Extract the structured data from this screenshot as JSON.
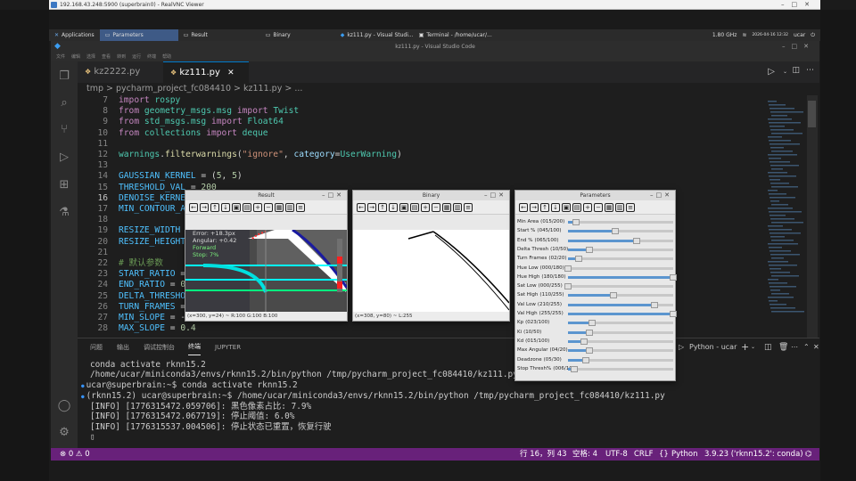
{
  "vnc": {
    "title": "192.168.43.248:5900 (superbrain0) - RealVNC Viewer"
  },
  "taskbar": {
    "applications": "Applications",
    "items": [
      "Parameters",
      "Result",
      "Binary",
      "kz111.py - Visual Studi...",
      "Terminal - /home/ucar/..."
    ],
    "freq": "1.80 GHz",
    "clock": "2026-04-16 12:32",
    "user": "ucar"
  },
  "window": {
    "title": "kz111.py - Visual Studio Code"
  },
  "menu": [
    "文件",
    "编辑",
    "选择",
    "查看",
    "转到",
    "运行",
    "终端",
    "帮助"
  ],
  "tabs": [
    {
      "label": "kz2222.py"
    },
    {
      "label": "kz111.py",
      "close": "✕"
    }
  ],
  "breadcrumb": {
    "text": "tmp > pycharm_project_fc084410 > kz111.py > ..."
  },
  "editor": {
    "line_numbers": [
      "7",
      "8",
      "9",
      "10",
      "11",
      "12",
      "13",
      "14",
      "15",
      "16",
      "17",
      "18",
      "19",
      "20",
      "21",
      "22",
      "23",
      "24",
      "25",
      "26",
      "27",
      "28"
    ],
    "lines": [
      [
        {
          "t": "import ",
          "c": "kw"
        },
        {
          "t": "rospy",
          "c": "cl"
        }
      ],
      [
        {
          "t": "from ",
          "c": "kw"
        },
        {
          "t": "geometry_msgs.msg",
          "c": "cl"
        },
        {
          "t": " import ",
          "c": "kw"
        },
        {
          "t": "Twist",
          "c": "cl"
        }
      ],
      [
        {
          "t": "from ",
          "c": "kw"
        },
        {
          "t": "std_msgs.msg",
          "c": "cl"
        },
        {
          "t": " import ",
          "c": "kw"
        },
        {
          "t": "Float64",
          "c": "cl"
        }
      ],
      [
        {
          "t": "from ",
          "c": "kw"
        },
        {
          "t": "collections",
          "c": "cl"
        },
        {
          "t": " import ",
          "c": "kw"
        },
        {
          "t": "deque",
          "c": "cl"
        }
      ],
      [],
      [
        {
          "t": "warnings",
          "c": "cl"
        },
        {
          "t": ".",
          "c": ""
        },
        {
          "t": "filterwarnings",
          "c": "fn"
        },
        {
          "t": "(",
          "c": ""
        },
        {
          "t": "\"ignore\"",
          "c": "str"
        },
        {
          "t": ", ",
          "c": ""
        },
        {
          "t": "category",
          "c": "pl"
        },
        {
          "t": "=",
          "c": ""
        },
        {
          "t": "UserWarning",
          "c": "cl"
        },
        {
          "t": ")",
          "c": ""
        }
      ],
      [],
      [
        {
          "t": "GAUSSIAN_KERNEL",
          "c": "cst"
        },
        {
          "t": " = (",
          "c": ""
        },
        {
          "t": "5",
          "c": "num"
        },
        {
          "t": ", ",
          "c": ""
        },
        {
          "t": "5",
          "c": "num"
        },
        {
          "t": ")",
          "c": ""
        }
      ],
      [
        {
          "t": "THRESHOLD_VAL",
          "c": "cst"
        },
        {
          "t": " = ",
          "c": ""
        },
        {
          "t": "200",
          "c": "num"
        }
      ],
      [
        {
          "t": "DENOISE_KERNEL",
          "c": "cst"
        }
      ],
      [
        {
          "t": "MIN_CONTOUR_AREA",
          "c": "cst"
        }
      ],
      [],
      [
        {
          "t": "RESIZE_WIDTH",
          "c": "cst"
        },
        {
          "t": " =",
          "c": ""
        }
      ],
      [
        {
          "t": "RESIZE_HEIGHT",
          "c": "cst"
        }
      ],
      [],
      [
        {
          "t": "# 默认参数",
          "c": "cm"
        }
      ],
      [
        {
          "t": "START_RATIO",
          "c": "cst"
        },
        {
          "t": " =",
          "c": ""
        }
      ],
      [
        {
          "t": "END_RATIO",
          "c": "cst"
        },
        {
          "t": " = ",
          "c": ""
        },
        {
          "t": "0.",
          "c": "num"
        }
      ],
      [
        {
          "t": "DELTA_THRESHOLD",
          "c": "cst"
        }
      ],
      [
        {
          "t": "TURN_FRAMES",
          "c": "cst"
        },
        {
          "t": " =",
          "c": ""
        }
      ],
      [
        {
          "t": "MIN_SLOPE",
          "c": "cst"
        },
        {
          "t": " = -",
          "c": ""
        }
      ],
      [
        {
          "t": "MAX_SLOPE",
          "c": "cst"
        },
        {
          "t": " = ",
          "c": ""
        },
        {
          "t": "0.4",
          "c": "num"
        }
      ]
    ]
  },
  "panel": {
    "tabs": [
      "问题",
      "输出",
      "调试控制台",
      "终端",
      "JUPYTER"
    ],
    "active_tab": "终端",
    "interpreter": "Python - ucar",
    "terminal": [
      {
        "text": "conda activate rknn15.2",
        "c": "#cccccc"
      },
      {
        "text": "/home/ucar/miniconda3/envs/rknn15.2/bin/python /tmp/pycharm_project_fc084410/kz111.py",
        "c": "#cccccc"
      },
      {
        "text": "ucar@superbrain:~$ conda activate rknn15.2",
        "c": "#cccccc",
        "prompt": "ucar@superbrain"
      },
      {
        "text": "(rknn15.2) ucar@superbrain:~$ /home/ucar/miniconda3/envs/rknn15.2/bin/python /tmp/pycharm_project_fc084410/kz111.py",
        "c": "#cccccc",
        "prompt": "(rknn15.2) ucar@superbrain"
      },
      {
        "text": "[INFO] [1776315472.059706]: 黑色像素占比: 7.9%",
        "c": "#cccccc"
      },
      {
        "text": "[INFO] [1776315472.067719]: 停止阈值: 6.0%",
        "c": "#cccccc"
      },
      {
        "text": "[INFO] [1776315537.004506]: 停止状态已重置，恢复行驶",
        "c": "#cccccc"
      },
      {
        "text": "▯",
        "c": "#cccccc"
      }
    ]
  },
  "status": {
    "errors": "⊗ 0 ⚠ 0",
    "pos": "行 16，列 43",
    "spaces": "空格: 4",
    "enc": "UTF-8",
    "eol": "CRLF",
    "lang": "Python",
    "interp": "3.9.23 ('rknn15.2': conda)"
  },
  "result_window": {
    "title": "Result",
    "overlay": [
      "Error: +18.3px",
      "Angular: +0.42",
      "Forward",
      "Stop: 7%"
    ],
    "statusbar": "(x=300, y=24) ~ R:100 G:100 B:100"
  },
  "binary_window": {
    "title": "Binary",
    "statusbar": "(x=308, y=80) ~ L:255"
  },
  "params_window": {
    "title": "Parameters",
    "rows": [
      {
        "label": "Min Area",
        "value": "(015/200)",
        "frac": 0.075
      },
      {
        "label": "Start %",
        "value": "(045/100)",
        "frac": 0.45
      },
      {
        "label": "End %",
        "value": "(065/100)",
        "frac": 0.65
      },
      {
        "label": "Delta Thresh",
        "value": "(10/50)",
        "frac": 0.2
      },
      {
        "label": "Turn Frames",
        "value": "(02/20)",
        "frac": 0.1
      },
      {
        "label": "Hue Low",
        "value": "(000/180)",
        "frac": 0.0
      },
      {
        "label": "Hue High",
        "value": "(180/180)",
        "frac": 1.0
      },
      {
        "label": "Sat Low",
        "value": "(000/255)",
        "frac": 0.0
      },
      {
        "label": "Sat High",
        "value": "(110/255)",
        "frac": 0.43
      },
      {
        "label": "Val Low",
        "value": "(210/255)",
        "frac": 0.82
      },
      {
        "label": "Val High",
        "value": "(255/255)",
        "frac": 1.0
      },
      {
        "label": "Kp",
        "value": "(023/100)",
        "frac": 0.23
      },
      {
        "label": "Ki",
        "value": "(10/50)",
        "frac": 0.2
      },
      {
        "label": "Kd",
        "value": "(015/100)",
        "frac": 0.15
      },
      {
        "label": "Max Angular",
        "value": "(04/20)",
        "frac": 0.2
      },
      {
        "label": "Deadzone",
        "value": "(05/30)",
        "frac": 0.17
      },
      {
        "label": "Stop Thresh%",
        "value": "(006/100)",
        "frac": 0.06
      }
    ]
  },
  "colors": {
    "statusbar": "#68217a",
    "accent": "#007acc"
  }
}
